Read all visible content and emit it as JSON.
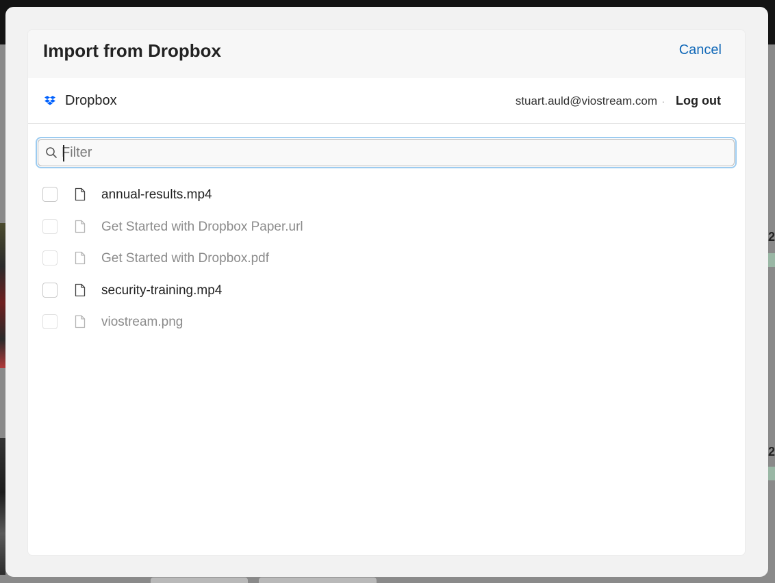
{
  "modal": {
    "title": "Import from Dropbox",
    "cancel_label": "Cancel"
  },
  "provider": {
    "name": "Dropbox",
    "icon": "dropbox-icon",
    "brand_color": "#0061fe",
    "user_email": "stuart.auld@viostream.com",
    "separator": "·",
    "logout_label": "Log out"
  },
  "filter": {
    "placeholder": "Filter",
    "value": "",
    "icon": "search-icon"
  },
  "files": [
    {
      "name": "annual-results.mp4",
      "enabled": true,
      "checked": false,
      "icon": "file-icon"
    },
    {
      "name": "Get Started with Dropbox Paper.url",
      "enabled": false,
      "checked": false,
      "icon": "file-icon"
    },
    {
      "name": "Get Started with Dropbox.pdf",
      "enabled": false,
      "checked": false,
      "icon": "file-icon"
    },
    {
      "name": "security-training.mp4",
      "enabled": true,
      "checked": false,
      "icon": "file-icon"
    },
    {
      "name": "viostream.png",
      "enabled": false,
      "checked": false,
      "icon": "file-icon"
    }
  ],
  "colors": {
    "accent_link": "#1269b8",
    "focus_ring": "#9ccbf0",
    "disabled_text": "#8b8b8b"
  }
}
